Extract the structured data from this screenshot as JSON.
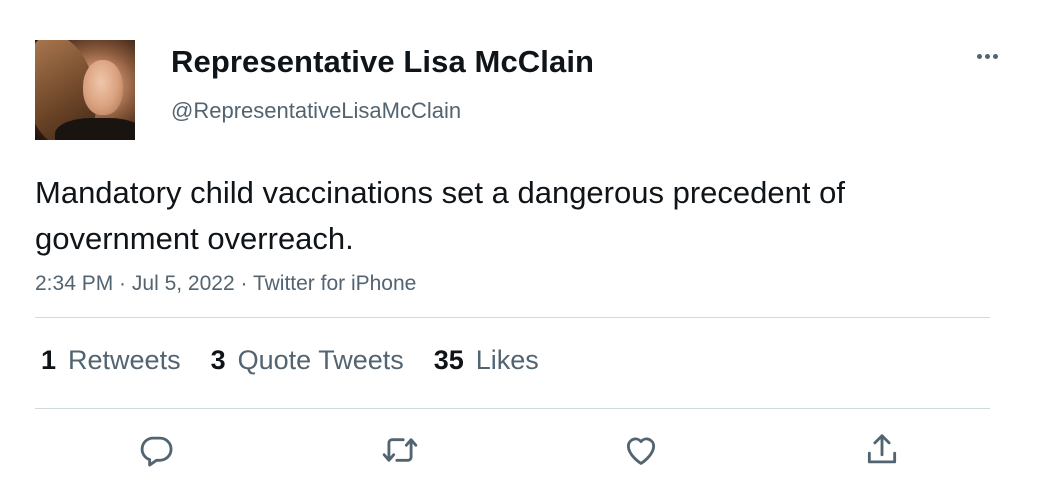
{
  "author": {
    "display_name": "Representative Lisa McClain",
    "handle": "@RepresentativeLisaMcClain"
  },
  "tweet": {
    "text": "Mandatory child vaccinations set a dangerous precedent of government overreach.",
    "time": "2:34 PM",
    "separator1": " · ",
    "date": "Jul 5, 2022",
    "separator2": " · ",
    "source": "Twitter for iPhone"
  },
  "stats": {
    "retweets_count": "1",
    "retweets_label": "Retweets",
    "quotes_count": "3",
    "quotes_label": "Quote Tweets",
    "likes_count": "35",
    "likes_label": "Likes"
  },
  "actions": {
    "icons": [
      "reply-icon",
      "retweet-icon",
      "like-icon",
      "share-icon"
    ],
    "icon_color": "#536471"
  },
  "colors": {
    "text_primary": "#0f1419",
    "text_secondary": "#536471",
    "divider": "#cfd9de",
    "background": "#ffffff"
  }
}
